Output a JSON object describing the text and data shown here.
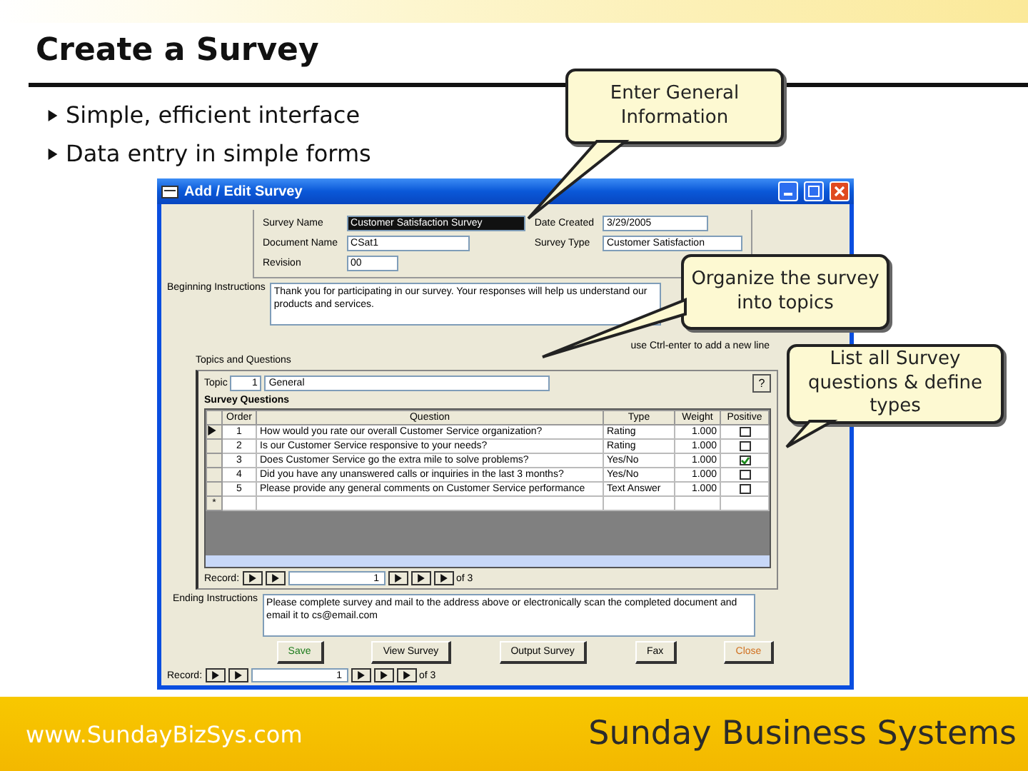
{
  "slide": {
    "title": "Create a Survey",
    "bullets": [
      "Simple, efficient interface",
      "Data entry in simple forms"
    ],
    "footer_left": "www.SundayBizSys.com",
    "footer_right": "Sunday Business Systems"
  },
  "callouts": [
    "Enter General Information",
    "Organize the survey into topics",
    "List all Survey questions & define types"
  ],
  "window": {
    "title": "Add / Edit Survey",
    "fields": [
      {
        "label": "Survey Name",
        "value": "Customer Satisfaction Survey",
        "selected": true
      },
      {
        "label": "Document Name",
        "value": "CSat1",
        "selected": false
      },
      {
        "label": "Revision",
        "value": "00",
        "selected": false
      }
    ],
    "date_created": {
      "label": "Date Created",
      "value": "3/29/2005"
    },
    "survey_type": {
      "label": "Survey Type",
      "value": "Customer Satisfaction"
    },
    "beginning_instructions": {
      "label": "Beginning Instructions",
      "value": "Thank you for participating in our survey. Your responses will help us understand our products and services."
    },
    "hint": "use Ctrl-enter to add a new line",
    "topics_label": "Topics and Questions",
    "topic": {
      "label": "Topic",
      "number": "1",
      "name": "General",
      "help": "?"
    },
    "questions_label": "Survey Questions",
    "columns": [
      "Order",
      "Question",
      "Type",
      "Weight",
      "Positive"
    ],
    "rows": [
      {
        "order": "1",
        "question": "How would you rate our overall Customer Service organization?",
        "type": "Rating",
        "weight": "1.000",
        "positive": false,
        "selected": true
      },
      {
        "order": "2",
        "question": "Is our Customer Service responsive to your needs?",
        "type": "Rating",
        "weight": "1.000",
        "positive": false,
        "selected": false
      },
      {
        "order": "3",
        "question": "Does Customer Service go the extra mile to solve problems?",
        "type": "Yes/No",
        "weight": "1.000",
        "positive": true,
        "selected": false
      },
      {
        "order": "4",
        "question": "Did you have any unanswered calls or inquiries in the last 3 months?",
        "type": "Yes/No",
        "weight": "1.000",
        "positive": false,
        "selected": false
      },
      {
        "order": "5",
        "question": "Please provide any general comments on Customer Service performance",
        "type": "Text Answer",
        "weight": "1.000",
        "positive": false,
        "selected": false
      }
    ],
    "new_row_mark": "*",
    "sub_record": {
      "label": "Record:",
      "current": "1",
      "total": "of 3"
    },
    "ending_instructions": {
      "label": "Ending Instructions",
      "value": "Please complete survey and mail to the address above or electronically scan the completed document and email it to cs@email.com"
    },
    "buttons": [
      "Save",
      "View Survey",
      "Output Survey",
      "Fax",
      "Close"
    ],
    "record": {
      "label": "Record:",
      "current": "1",
      "total": "of 3"
    }
  }
}
